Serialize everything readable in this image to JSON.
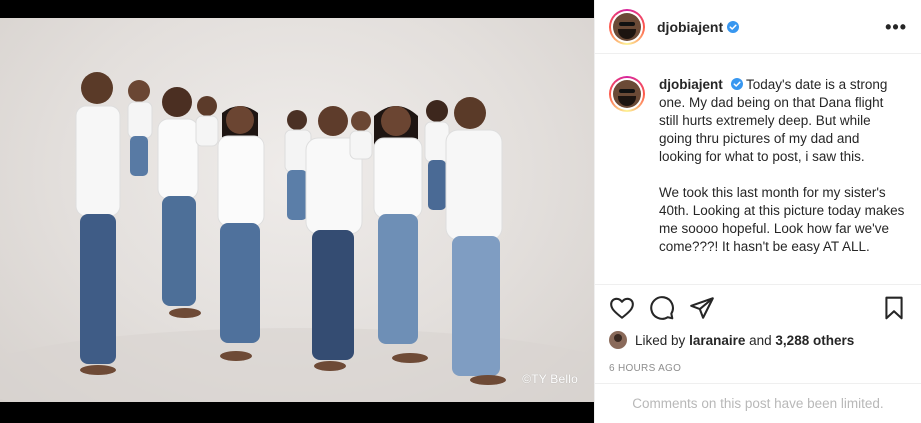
{
  "post": {
    "photo_alt": "Family portrait",
    "credit": "©TY Bello"
  },
  "header": {
    "username": "djobiajent",
    "verified": true,
    "more_icon": "more-horizontal-icon"
  },
  "caption": {
    "username": "djobiajent",
    "paragraph_1": "Today's date is a strong one. My dad being on that Dana flight still hurts extremely deep. But while going thru pictures of my dad and looking for what to post, i saw this.",
    "paragraph_2": "We took this last month for my sister's 40th. Looking at this picture today makes me soooo hopeful. Look how far we've come???! It hasn't be easy AT ALL."
  },
  "actions": {
    "like_icon": "heart-icon",
    "comment_icon": "comment-icon",
    "share_icon": "send-icon",
    "save_icon": "bookmark-icon"
  },
  "likes": {
    "prefix": "Liked by",
    "user": "laranaire",
    "connector": "and",
    "others": "3,288 others"
  },
  "timestamp": "6 HOURS AGO",
  "comments_notice": "Comments on this post have been limited.",
  "colors": {
    "verified_blue": "#3897f0",
    "text_primary": "#262626",
    "text_secondary": "#8e8e8e",
    "divider": "#efefef"
  }
}
